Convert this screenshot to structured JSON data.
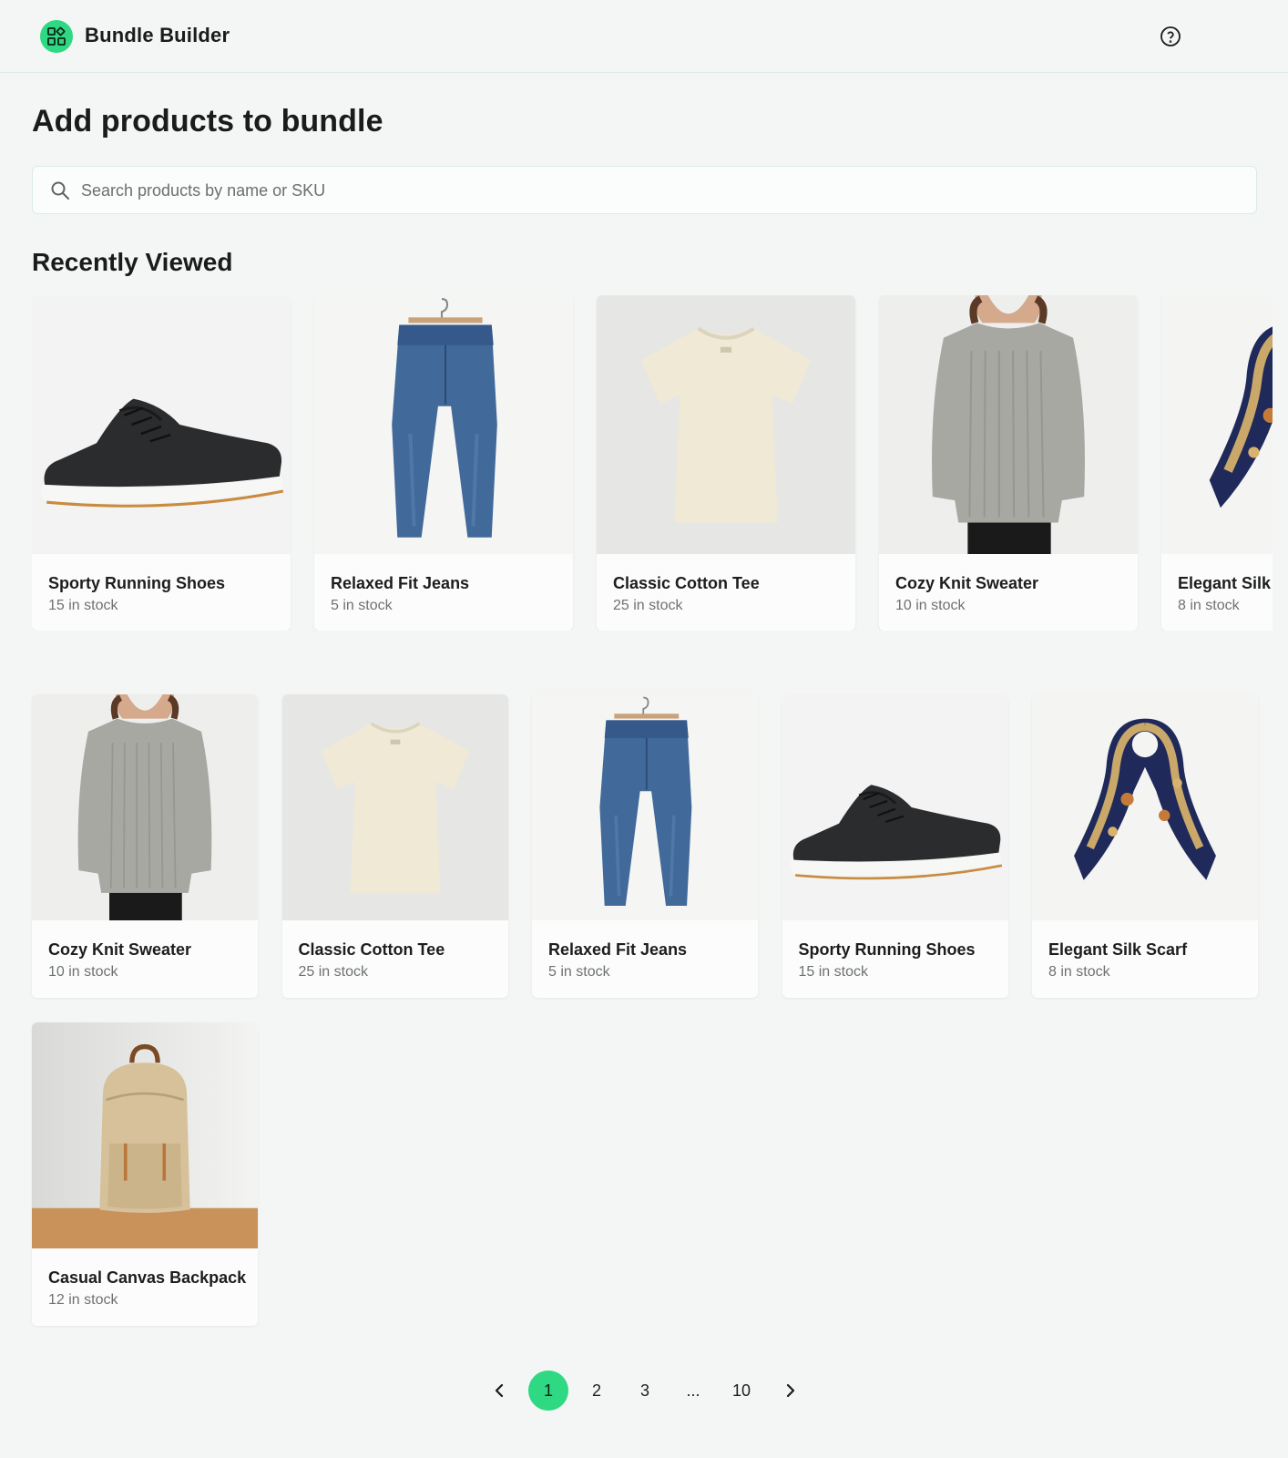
{
  "app": {
    "title": "Bundle Builder"
  },
  "page": {
    "title": "Add products to bundle"
  },
  "search": {
    "placeholder": "Search products by name or SKU",
    "value": ""
  },
  "recently_viewed": {
    "title": "Recently Viewed",
    "items": [
      {
        "name": "Sporty Running Shoes",
        "stock": "15 in stock",
        "image": "shoe"
      },
      {
        "name": "Relaxed Fit Jeans",
        "stock": "5 in stock",
        "image": "jeans"
      },
      {
        "name": "Classic Cotton Tee",
        "stock": "25 in stock",
        "image": "tee"
      },
      {
        "name": "Cozy Knit Sweater",
        "stock": "10 in stock",
        "image": "sweater"
      },
      {
        "name": "Elegant Silk Scarf",
        "stock": "8 in stock",
        "image": "scarf"
      }
    ]
  },
  "products": {
    "items": [
      {
        "name": "Cozy Knit Sweater",
        "stock": "10 in stock",
        "image": "sweater"
      },
      {
        "name": "Classic Cotton Tee",
        "stock": "25 in stock",
        "image": "tee"
      },
      {
        "name": "Relaxed Fit Jeans",
        "stock": "5 in stock",
        "image": "jeans"
      },
      {
        "name": "Sporty Running Shoes",
        "stock": "15 in stock",
        "image": "shoe"
      },
      {
        "name": "Elegant Silk Scarf",
        "stock": "8 in stock",
        "image": "scarf"
      },
      {
        "name": "Casual Canvas Backpack",
        "stock": "12 in stock",
        "image": "backpack"
      }
    ]
  },
  "pagination": {
    "prev_icon": "chevron-left-icon",
    "next_icon": "chevron-right-icon",
    "pages": [
      "1",
      "2",
      "3",
      "...",
      "10"
    ],
    "current": "1"
  },
  "icons": {
    "logo": "grid-shapes-icon",
    "help": "question-circle-icon",
    "search": "search-icon"
  },
  "colors": {
    "accent": "#2fd882",
    "background": "#f4f6f5",
    "text": "#1a1c1b",
    "muted": "#6d7270"
  }
}
